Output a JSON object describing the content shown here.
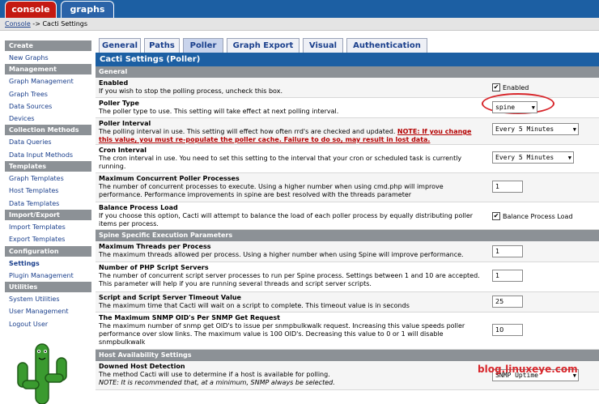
{
  "top_tabs": {
    "console": "console",
    "graphs": "graphs"
  },
  "breadcrumb": {
    "link": "Console",
    "separator": " -> ",
    "current": "Cacti Settings"
  },
  "sidebar": [
    {
      "type": "head",
      "label": "Create"
    },
    {
      "type": "item",
      "label": "New Graphs"
    },
    {
      "type": "head",
      "label": "Management"
    },
    {
      "type": "item",
      "label": "Graph Management"
    },
    {
      "type": "item",
      "label": "Graph Trees"
    },
    {
      "type": "item",
      "label": "Data Sources"
    },
    {
      "type": "item",
      "label": "Devices"
    },
    {
      "type": "head",
      "label": "Collection Methods"
    },
    {
      "type": "item",
      "label": "Data Queries"
    },
    {
      "type": "item",
      "label": "Data Input Methods"
    },
    {
      "type": "head",
      "label": "Templates"
    },
    {
      "type": "item",
      "label": "Graph Templates"
    },
    {
      "type": "item",
      "label": "Host Templates"
    },
    {
      "type": "item",
      "label": "Data Templates"
    },
    {
      "type": "head",
      "label": "Import/Export"
    },
    {
      "type": "item",
      "label": "Import Templates"
    },
    {
      "type": "item",
      "label": "Export Templates"
    },
    {
      "type": "head",
      "label": "Configuration"
    },
    {
      "type": "item",
      "label": "Settings",
      "active": true
    },
    {
      "type": "item",
      "label": "Plugin Management"
    },
    {
      "type": "head",
      "label": "Utilities"
    },
    {
      "type": "item",
      "label": "System Utilities"
    },
    {
      "type": "item",
      "label": "User Management"
    },
    {
      "type": "item",
      "label": "Logout User"
    }
  ],
  "tabs": [
    "General",
    "Paths",
    "Poller",
    "Graph Export",
    "Visual",
    "Authentication"
  ],
  "active_tab": "Poller",
  "panel_title": "Cacti Settings (Poller)",
  "sections": {
    "general": "General",
    "spine": "Spine Specific Execution Parameters",
    "host": "Host Availability Settings"
  },
  "rows": {
    "enabled": {
      "label": "Enabled",
      "desc": "If you wish to stop the polling process, uncheck this box.",
      "check": "✔",
      "check_label": "Enabled"
    },
    "poller_type": {
      "label": "Poller Type",
      "desc": "The poller type to use. This setting will take effect at next polling interval.",
      "value": "spine"
    },
    "poller_interval": {
      "label": "Poller Interval",
      "desc": "The polling interval in use. This setting will effect how often rrd's are checked and updated. ",
      "note": "NOTE: If you change this value, you must re-populate the poller cache. Failure to do so, may result in lost data.",
      "value": "Every 5 Minutes"
    },
    "cron_interval": {
      "label": "Cron Interval",
      "desc": "The cron interval in use. You need to set this setting to the interval that your cron or scheduled task is currently running.",
      "value": "Every 5 Minutes"
    },
    "max_procs": {
      "label": "Maximum Concurrent Poller Processes",
      "desc": "The number of concurrent processes to execute. Using a higher number when using cmd.php will improve performance. Performance improvements in spine are best resolved with the threads parameter",
      "value": "1"
    },
    "balance": {
      "label": "Balance Process Load",
      "desc": "If you choose this option, Cacti will attempt to balance the load of each poller process by equally distributing poller items per process.",
      "check": "✔",
      "check_label": "Balance Process Load"
    },
    "max_threads": {
      "label": "Maximum Threads per Process",
      "desc": "The maximum threads allowed per process. Using a higher number when using Spine will improve performance.",
      "value": "1"
    },
    "php_servers": {
      "label": "Number of PHP Script Servers",
      "desc": "The number of concurrent script server processes to run per Spine process. Settings between 1 and 10 are accepted. This parameter will help if you are running several threads and script server scripts.",
      "value": "1"
    },
    "timeout": {
      "label": "Script and Script Server Timeout Value",
      "desc": "The maximum time that Cacti will wait on a script to complete. This timeout value is in seconds",
      "value": "25"
    },
    "snmp_oids": {
      "label": "The Maximum SNMP OID's Per SNMP Get Request",
      "desc": "The maximum number of snmp get OID's to issue per snmpbulkwalk request. Increasing this value speeds poller performance over slow links. The maximum value is 100 OID's. Decreasing this value to 0 or 1 will disable snmpbulkwalk",
      "value": "10"
    },
    "downed_host": {
      "label": "Downed Host Detection",
      "desc": "The method Cacti will use to determine if a host is available for polling.",
      "note": "NOTE: It is recommended that, at a minimum, SNMP always be selected.",
      "value": "SNMP Uptime"
    }
  },
  "watermark": "blog.linuxeye.com",
  "colors": {
    "header_blue": "#1c5fa3",
    "console_red": "#c41a12",
    "section_grey": "#8c9196",
    "highlight_red": "#d8262b"
  }
}
